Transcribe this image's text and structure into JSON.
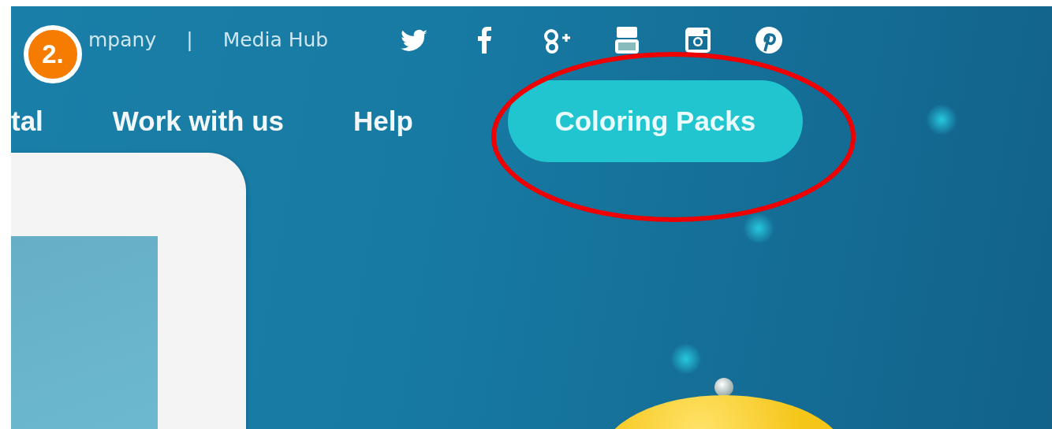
{
  "top_links": [
    {
      "label": "mpany"
    },
    {
      "label": "Media Hub"
    }
  ],
  "top_separator": "|",
  "nav": {
    "items": [
      "tal",
      "Work with us",
      "Help"
    ],
    "cta": "Coloring Packs"
  },
  "annotation": {
    "badge": "2."
  }
}
